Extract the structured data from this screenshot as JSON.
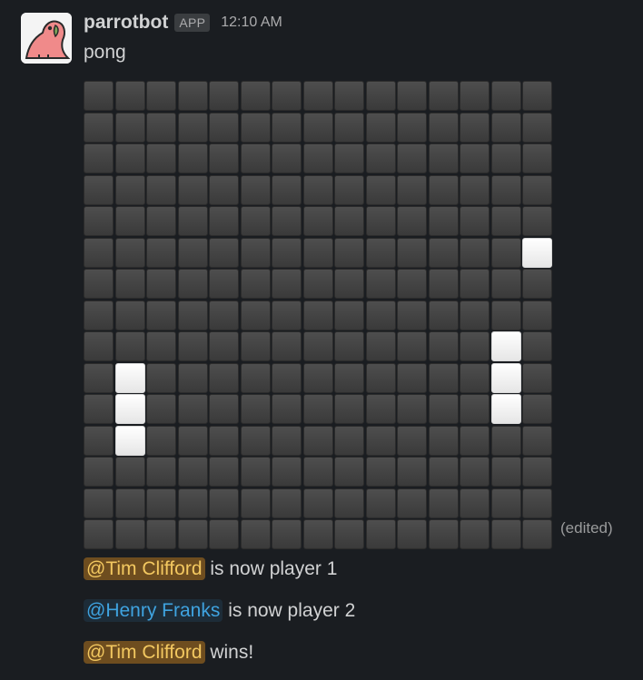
{
  "message": {
    "username": "parrotbot",
    "badge": "APP",
    "timestamp": "12:10 AM",
    "text": "pong",
    "edited_label": "(edited)"
  },
  "board": {
    "columns": 15,
    "rows": 15,
    "lit_cells": [
      [
        5,
        14
      ],
      [
        8,
        13
      ],
      [
        9,
        13
      ],
      [
        10,
        13
      ],
      [
        9,
        1
      ],
      [
        10,
        1
      ],
      [
        11,
        1
      ]
    ]
  },
  "events": [
    {
      "mention": "@Tim Clifford",
      "mention_style": "self",
      "text": " is now player 1"
    },
    {
      "mention": "@Henry Franks",
      "mention_style": "other",
      "text": " is now player 2"
    },
    {
      "mention": "@Tim Clifford",
      "mention_style": "self",
      "text": " wins!"
    }
  ],
  "colors": {
    "background": "#1a1d21",
    "self_mention_bg": "#6e4d1f",
    "self_mention_fg": "#f3c860",
    "other_mention_bg": "#1d2c38",
    "other_mention_fg": "#3fa3e0"
  },
  "icons": {
    "avatar": "parrot-icon"
  }
}
